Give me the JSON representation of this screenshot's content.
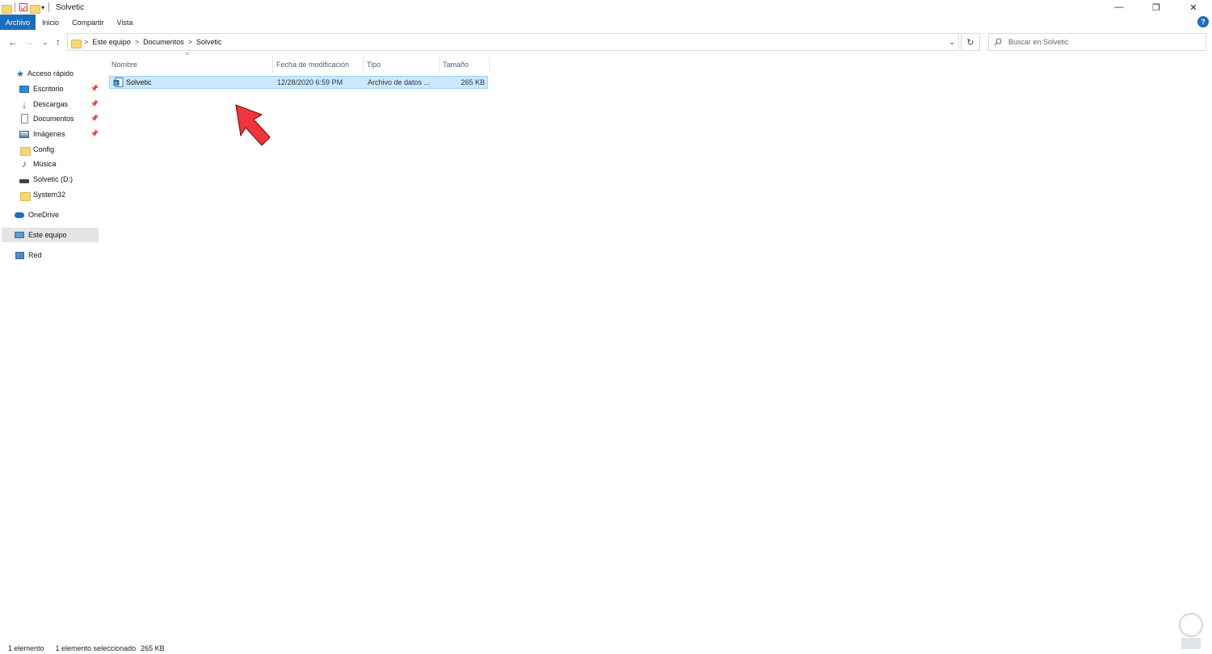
{
  "window": {
    "title": "Solvetic",
    "controls": {
      "minimize": "—",
      "maximize": "❐",
      "close": "✕"
    }
  },
  "ribbon": {
    "tabs": [
      "Archivo",
      "Inicio",
      "Compartir",
      "Vista"
    ],
    "help": "?"
  },
  "address": {
    "crumbs": [
      "Este equipo",
      "Documentos",
      "Solvetic"
    ],
    "separator": ">"
  },
  "search": {
    "placeholder": "Buscar en Solvetic"
  },
  "navpane": {
    "quick_access": "Acceso rápido",
    "items": [
      {
        "label": "Escritorio",
        "icon": "desktop-icon",
        "pinned": true
      },
      {
        "label": "Descargas",
        "icon": "download-icon",
        "pinned": true
      },
      {
        "label": "Documentos",
        "icon": "document-icon",
        "pinned": true
      },
      {
        "label": "Imágenes",
        "icon": "pictures-icon",
        "pinned": true
      },
      {
        "label": "Config",
        "icon": "folder-icon",
        "pinned": false
      },
      {
        "label": "Música",
        "icon": "music-icon",
        "pinned": false
      },
      {
        "label": "Solvetic (D:)",
        "icon": "drive-icon",
        "pinned": false
      },
      {
        "label": "System32",
        "icon": "folder-icon",
        "pinned": false
      }
    ],
    "onedrive": "OneDrive",
    "this_pc": "Este equipo",
    "network": "Red"
  },
  "columns": [
    "Nombre",
    "Fecha de modificación",
    "Tipo",
    "Tamaño"
  ],
  "files": [
    {
      "name": "Solvetic",
      "modified": "12/28/2020 6:59 PM",
      "type": "Archivo de datos ...",
      "size": "265 KB",
      "selected": true
    }
  ],
  "status": {
    "count": "1 elemento",
    "selection": "1 elemento seleccionado",
    "size": "265 KB"
  },
  "colors": {
    "accent": "#1a6ec2",
    "selection_fill": "#cce8ff",
    "selection_border": "#99d1ff",
    "annotation_arrow": "#f0353c"
  }
}
